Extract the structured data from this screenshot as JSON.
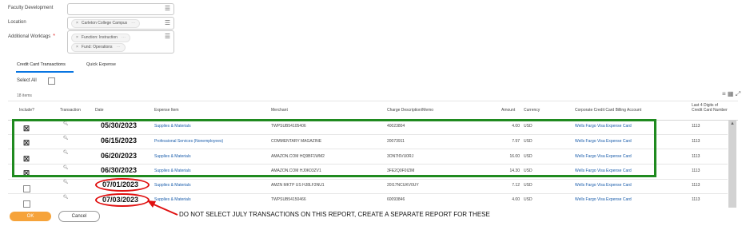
{
  "form": {
    "faculty_development": {
      "label": "Faculty Development"
    },
    "location": {
      "label": "Location",
      "pill": "Carleton College Campus"
    },
    "additional_worktags": {
      "label": "Additional Worktags",
      "required_mark": "*",
      "pills": [
        "Function: Instruction",
        "Fund: Operations"
      ]
    }
  },
  "tabs": [
    {
      "label": "Credit Card Transactions",
      "active": true
    },
    {
      "label": "Quick Expense",
      "active": false
    }
  ],
  "select_all_label": "Select All",
  "items_count": "18 items",
  "table": {
    "headers": [
      "Include?",
      "Transaction",
      "Date",
      "Expense Item",
      "Merchant",
      "Charge Description/Memo",
      "Amount",
      "Currency",
      "Corporate Credit Card Billing Account",
      "Last 4 Digits of Credit Card Number"
    ],
    "rows": [
      {
        "checked": true,
        "date": "05/30/2023",
        "item": "Supplies & Materials",
        "merchant": "TWPSUB54105406",
        "memo": "40023804",
        "amount": "4.00",
        "currency": "USD",
        "account": "Wells Fargo Visa Expense Card",
        "last4": "1113"
      },
      {
        "checked": true,
        "date": "06/15/2023",
        "item": "Professional Services (Nonemployees)",
        "merchant": "COMMENTARY MAGAZINE",
        "memo": "20073911",
        "amount": "7.97",
        "currency": "USD",
        "account": "Wells Fargo Visa Expense Card",
        "last4": "1113"
      },
      {
        "checked": true,
        "date": "06/20/2023",
        "item": "Supplies & Materials",
        "merchant": "AMAZON.COM HQ9BF1WM2",
        "memo": "3ON7I6VU0RJ",
        "amount": "16.00",
        "currency": "USD",
        "account": "Wells Fargo Visa Expense Card",
        "last4": "1113"
      },
      {
        "checked": true,
        "date": "06/30/2023",
        "item": "Supplies & Materials",
        "merchant": "AMAZON.COM HJ0K03ZV1",
        "memo": "3FE2Q0F0IZIM",
        "amount": "14.30",
        "currency": "USD",
        "account": "Wells Fargo Visa Expense Card",
        "last4": "1113"
      },
      {
        "checked": false,
        "date": "07/01/2023",
        "item": "Supplies & Materials",
        "merchant": "AMZN MKTP US HJ8LF3NU1",
        "memo": "20I17NCUKV0UY",
        "amount": "7.12",
        "currency": "USD",
        "account": "Wells Fargo Visa Expense Card",
        "last4": "1113"
      },
      {
        "checked": false,
        "date": "07/03/2023",
        "item": "Supplies & Materials",
        "merchant": "TWPSUB54150466",
        "memo": "60093846",
        "amount": "4.00",
        "currency": "USD",
        "account": "Wells Fargo Visa Expense Card",
        "last4": "1113"
      }
    ]
  },
  "annotation": "DO NOT SELECT JULY TRANSACTIONS ON THIS REPORT, CREATE A SEPARATE REPORT FOR THESE",
  "buttons": {
    "ok": "OK",
    "cancel": "Cancel"
  },
  "colors": {
    "highlight_box": "#1f8a1f",
    "annotation_red": "#e01010",
    "ok_orange": "#f6a33a",
    "link_blue": "#1a5dab",
    "tab_blue": "#0875e1"
  }
}
